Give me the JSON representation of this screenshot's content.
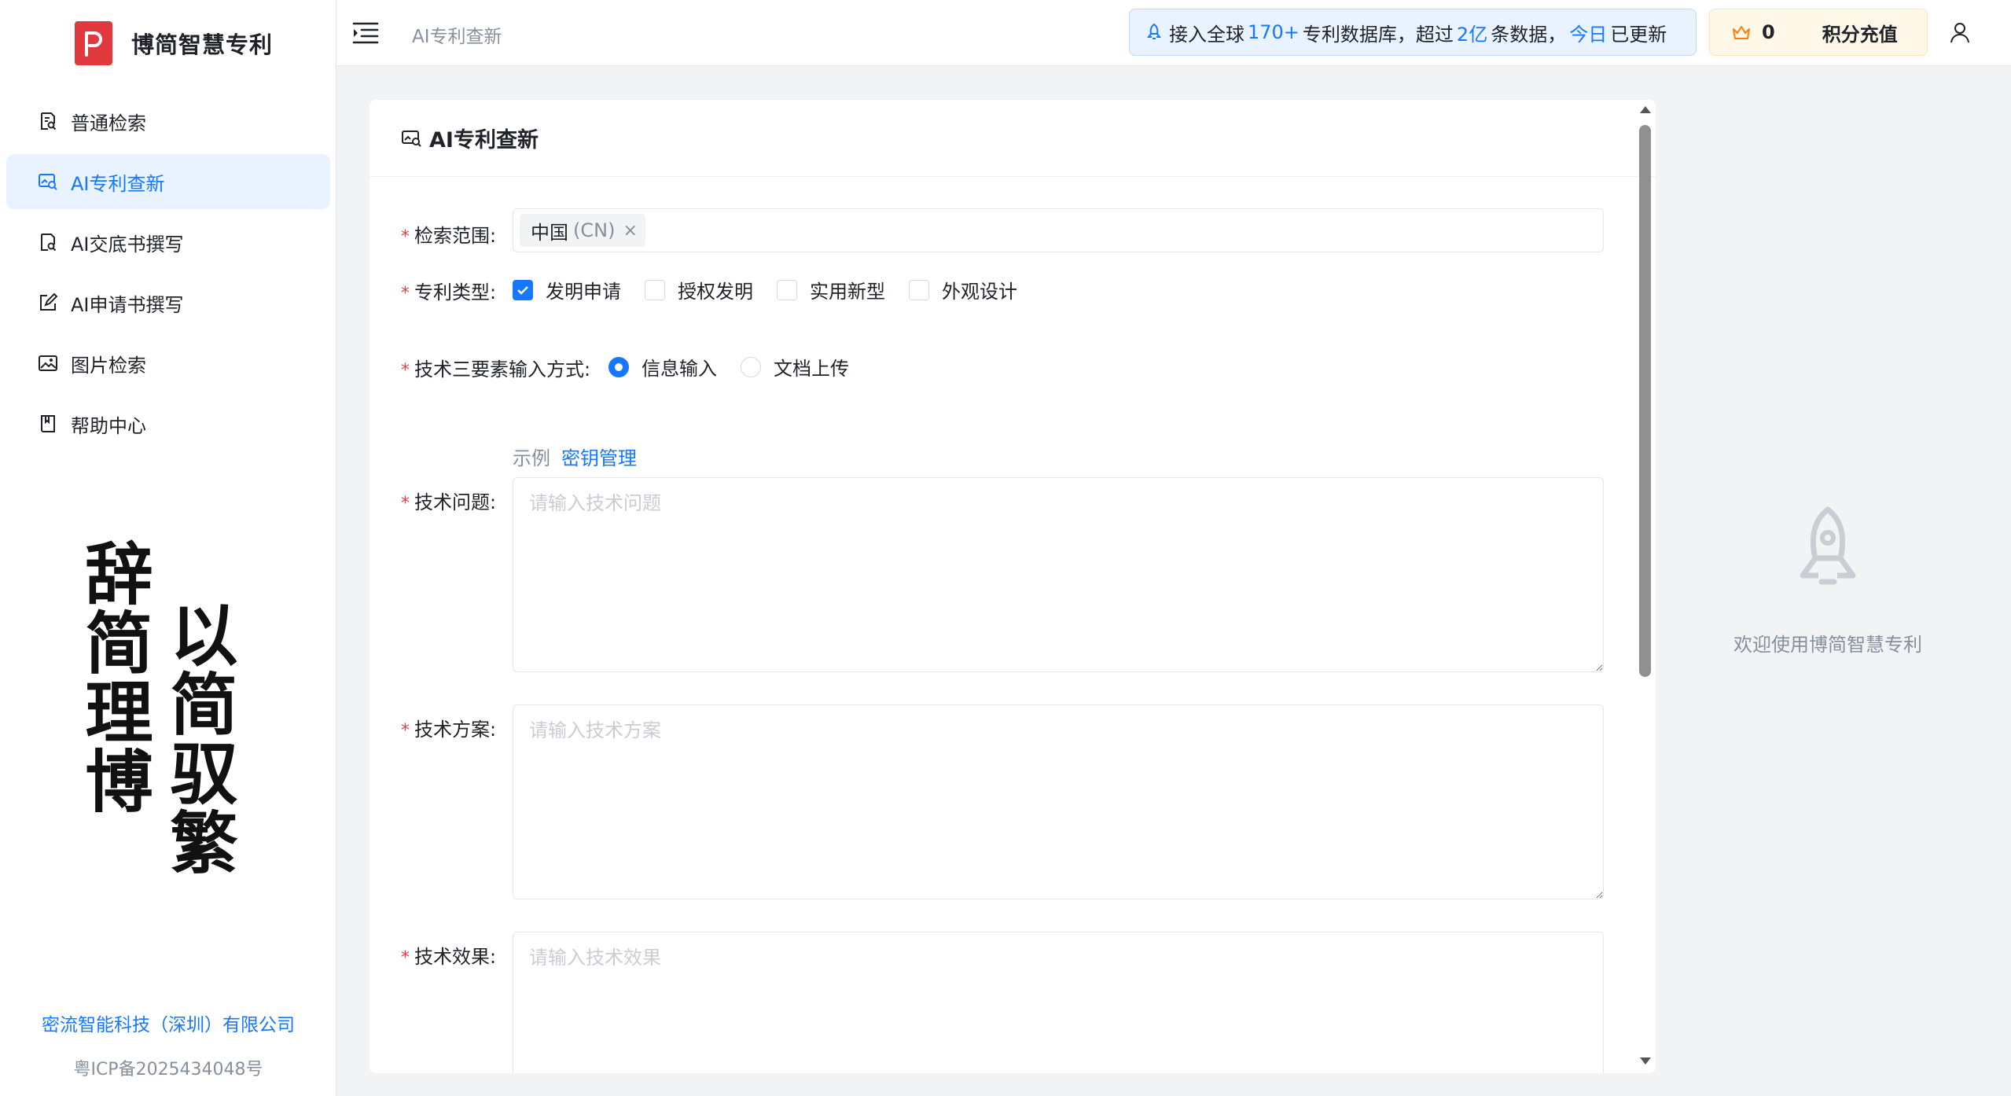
{
  "brand": {
    "name": "博简智慧专利",
    "logo_icon": "brand-p-logo",
    "logo_color": "#e0393e"
  },
  "sidebar": {
    "items": [
      {
        "label": "普通检索",
        "icon": "search-doc-icon",
        "active": false
      },
      {
        "label": "AI专利查新",
        "icon": "image-search-icon",
        "active": true
      },
      {
        "label": "AI交底书撰写",
        "icon": "doc-search-icon",
        "active": false
      },
      {
        "label": "AI申请书撰写",
        "icon": "edit-icon",
        "active": false
      },
      {
        "label": "图片检索",
        "icon": "picture-icon",
        "active": false
      },
      {
        "label": "帮助中心",
        "icon": "book-icon",
        "active": false
      }
    ],
    "calligraphy": {
      "left": "辞简理博",
      "right": "以简驭繁"
    },
    "company": "密流智能科技（深圳）有限公司",
    "icp": "粤ICP备2025434048号"
  },
  "header": {
    "breadcrumb": "AI专利查新",
    "notice": {
      "p1": "接入全球",
      "h1": "170+",
      "p2": "专利数据库，超过",
      "h2": "2亿",
      "p3": "条数据，",
      "h3": "今日",
      "p4": "已更新"
    },
    "points": "0",
    "recharge_label": "积分充值"
  },
  "card": {
    "title": "AI专利查新",
    "scope": {
      "label": "检索范围:",
      "tag": "中国",
      "tag_sub": "(CN)",
      "tag_close": "×"
    },
    "patent_type": {
      "label": "专利类型:",
      "options": [
        {
          "label": "发明申请",
          "checked": true
        },
        {
          "label": "授权发明",
          "checked": false
        },
        {
          "label": "实用新型",
          "checked": false
        },
        {
          "label": "外观设计",
          "checked": false
        }
      ]
    },
    "input_mode": {
      "label": "技术三要素输入方式:",
      "options": [
        {
          "label": "信息输入",
          "checked": true
        },
        {
          "label": "文档上传",
          "checked": false
        }
      ]
    },
    "helper": {
      "example": "示例",
      "key_manage": "密钥管理"
    },
    "tech_problem": {
      "label": "技术问题:",
      "placeholder": "请输入技术问题",
      "value": ""
    },
    "tech_solution": {
      "label": "技术方案:",
      "placeholder": "请输入技术方案",
      "value": ""
    },
    "tech_effect": {
      "label": "技术效果:",
      "placeholder": "请输入技术效果",
      "value": ""
    }
  },
  "welcome": {
    "text": "欢迎使用博简智慧专利",
    "icon": "rocket-icon"
  },
  "colors": {
    "accent": "#1677ff",
    "required": "#f53f3f",
    "active_bg": "#e8f3ff"
  }
}
